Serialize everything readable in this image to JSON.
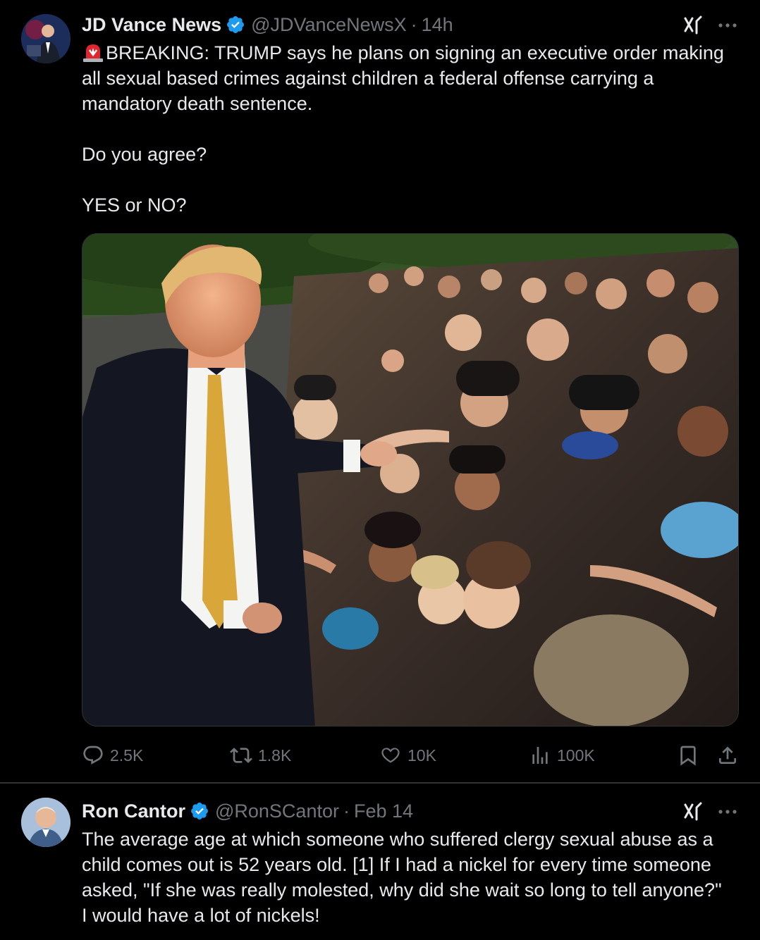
{
  "tweets": [
    {
      "author_name": "JD Vance News",
      "handle": "@JDVanceNewsX",
      "separator": "·",
      "time": "14h",
      "lines": [
        "BREAKING: TRUMP says he plans on signing an executive order making",
        "all sexual based crimes against children a federal offense carrying a",
        "mandatory death sentence.",
        "Do you agree?",
        "YES or NO?"
      ],
      "lead_emoji": "rotating-light-icon",
      "media_description_icon": "photo-image",
      "stats": {
        "replies": "2.5K",
        "reposts": "1.8K",
        "likes": "10K",
        "views": "100K"
      }
    },
    {
      "author_name": "Ron Cantor",
      "handle": "@RonSCantor",
      "separator": "·",
      "time": "Feb 14",
      "lines": [
        "The average age at which someone who suffered clergy sexual abuse as a",
        "child comes out is 52 years old. [1] If I had a nickel for every time someone",
        "asked, \"If she was really molested, why did she wait so long to tell anyone?\"",
        "I would have a lot of nickels!"
      ]
    }
  ],
  "colors": {
    "background": "#000000",
    "text": "#e7e9ea",
    "secondary": "#71767b",
    "verified": "#1d9bf0",
    "divider": "#2f3336"
  }
}
